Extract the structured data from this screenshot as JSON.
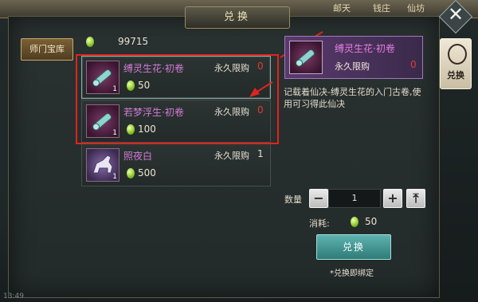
{
  "top_links": [
    "邮天",
    "钱庄",
    "仙坊"
  ],
  "title": "兑换",
  "close_label": "✕",
  "category": {
    "label": "师门宝库"
  },
  "currency": {
    "balance": "99715"
  },
  "items": [
    {
      "name": "缚灵生花·初卷",
      "limit_label": "永久限购",
      "limit_value": "0",
      "price": "50",
      "count": "1"
    },
    {
      "name": "若梦浮生·初卷",
      "limit_label": "永久限购",
      "limit_value": "0",
      "price": "100",
      "count": "1"
    },
    {
      "name": "照夜白",
      "limit_label": "永久限购",
      "limit_value": "1",
      "price": "500",
      "count": "1"
    }
  ],
  "detail": {
    "name": "缚灵生花·初卷",
    "limit_label": "永久限购",
    "limit_value": "0",
    "description": "记载着仙决-缚灵生花的入门古卷,使用可习得此仙决"
  },
  "side_tab": {
    "label": "兑换"
  },
  "quantity": {
    "label": "数量",
    "value": "1",
    "minus": "−",
    "plus": "+",
    "max": "⤒"
  },
  "cost": {
    "label": "消耗:",
    "value": "50"
  },
  "exchange_button": {
    "label": "兑换"
  },
  "bind_note": "*兑换即绑定",
  "clock": "13:49",
  "colors": {
    "annotation": "#e0241d",
    "item_name": "#d47ad6",
    "limit_zero": "#e23a30",
    "exchange": "#2f7b78"
  }
}
